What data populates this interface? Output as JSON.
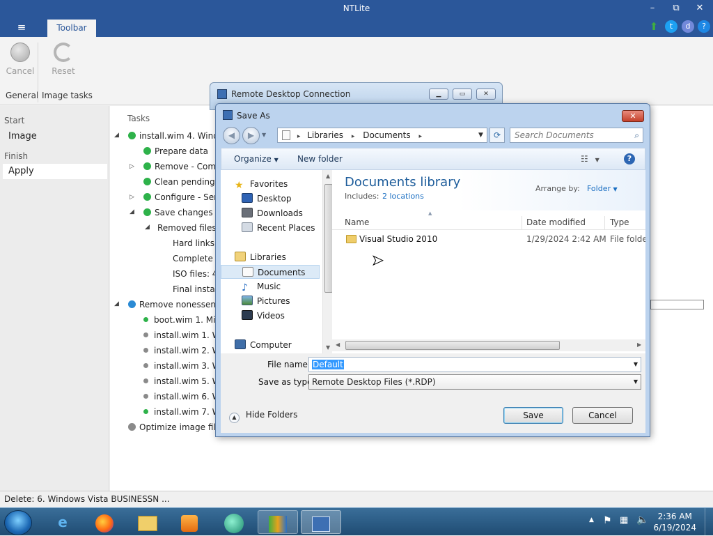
{
  "app": {
    "title": "NTLite",
    "tab": "Toolbar",
    "menu_glyph": "≡",
    "window_controls": {
      "minimize": "–",
      "maximize": "⧉",
      "close": "✕"
    },
    "ribbon": {
      "cancel_label": "Cancel",
      "reset_label": "Reset",
      "group_general": "General",
      "group_image_tasks": "Image tasks"
    },
    "nav": {
      "start_header": "Start",
      "image": "Image",
      "finish_header": "Finish",
      "apply": "Apply"
    },
    "tasks_header": "Tasks",
    "tasks": [
      {
        "text": "install.wim 4. Windo",
        "dot": "green"
      },
      {
        "text": "Prepare data",
        "dot": "green"
      },
      {
        "text": "Remove - Com",
        "dot": "green"
      },
      {
        "text": "Clean pending",
        "dot": "green"
      },
      {
        "text": "Configure - Ser",
        "dot": "green"
      },
      {
        "text": "Save changes t",
        "dot": "green"
      },
      {
        "text": "Removed files",
        "dot": ""
      },
      {
        "text": "Hard links",
        "dot": ""
      },
      {
        "text": "Complete",
        "dot": ""
      },
      {
        "text": "ISO files: 4",
        "dot": ""
      },
      {
        "text": "Final insta",
        "dot": ""
      },
      {
        "text": "Remove nonessent",
        "dot": "blue"
      },
      {
        "text": "boot.wim 1. Mi",
        "dot": "green-small"
      },
      {
        "text": "install.wim 1. W",
        "dot": "gray-small"
      },
      {
        "text": "install.wim 2. W",
        "dot": "gray-small"
      },
      {
        "text": "install.wim 3. W",
        "dot": "gray-small"
      },
      {
        "text": "install.wim 5. W",
        "dot": "gray-small"
      },
      {
        "text": "install.wim 6. W",
        "dot": "gray-small"
      },
      {
        "text": "install.wim 7. W",
        "dot": "green-small"
      },
      {
        "text": "Optimize image file s",
        "dot": "gray"
      }
    ],
    "status": "Delete: 6. Windows Vista BUSINESSN ...",
    "colors": {
      "accent": "#2b579a",
      "green": "#2eb24a",
      "blue": "#2a8ad4",
      "gray": "#8a8a8a"
    }
  },
  "rdc": {
    "title": "Remote Desktop Connection"
  },
  "dialog": {
    "title": "Save As",
    "address": {
      "part1": "Libraries",
      "part2": "Documents",
      "sep": "▸"
    },
    "search_placeholder": "Search Documents",
    "organize": "Organize",
    "new_folder": "New folder",
    "nav": {
      "favorites": "Favorites",
      "desktop": "Desktop",
      "downloads": "Downloads",
      "recent": "Recent Places",
      "libraries": "Libraries",
      "documents": "Documents",
      "music": "Music",
      "pictures": "Pictures",
      "videos": "Videos",
      "computer": "Computer"
    },
    "library_title": "Documents library",
    "includes_label": "Includes:",
    "includes_link": "2 locations",
    "arrange_label": "Arrange by:",
    "arrange_value": "Folder",
    "columns": {
      "name": "Name",
      "date": "Date modified",
      "type": "Type"
    },
    "files": [
      {
        "name": "Visual Studio 2010",
        "date": "1/29/2024 2:42 AM",
        "type": "File folder"
      }
    ],
    "file_name_label": "File name:",
    "file_name_value": "Default",
    "save_type_label": "Save as type:",
    "save_type_value": "Remote Desktop Files (*.RDP)",
    "hide_folders": "Hide Folders",
    "save_button": "Save",
    "cancel_button": "Cancel"
  },
  "taskbar": {
    "time": "2:36 AM",
    "date": "6/19/2024"
  }
}
